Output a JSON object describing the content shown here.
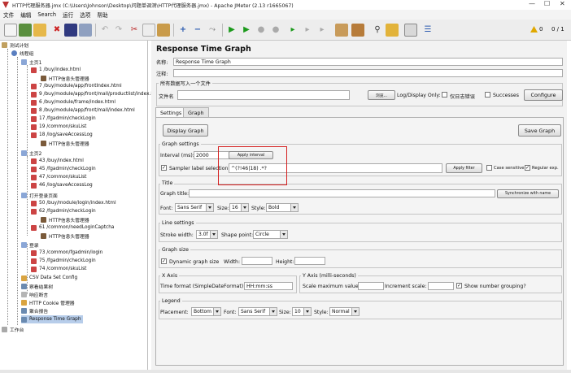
{
  "window": {
    "title": "HTTP代理服务器.jmx (C:\\Users\\Johnson\\Desktop\\问题单调测\\HTTP代理服务器.jmx) - Apache JMeter (2.13 r1665067)",
    "minimize": "—",
    "maximize": "☐",
    "close": "✕"
  },
  "menu": [
    "文件",
    "编辑",
    "Search",
    "运行",
    "选项",
    "帮助"
  ],
  "toolbar": {
    "warning_count": "0",
    "thread_count": "0 / 1"
  },
  "tree": {
    "items": [
      {
        "label": "测试计划"
      },
      {
        "label": "线程组"
      },
      {
        "label": "主页1"
      },
      {
        "label": "1 /buy/index.html"
      },
      {
        "label": "HTTP信息头管理器"
      },
      {
        "label": "7 /buy/module/app/frontIndex.html"
      },
      {
        "label": "9 /buy/module/app/front/mall/productlist/index.h"
      },
      {
        "label": "6 /buy/module/frame/index.html"
      },
      {
        "label": "8 /buy/module/app/front/mall/index.html"
      },
      {
        "label": "17 /fgadmin/checkLogin"
      },
      {
        "label": "19 /common/skuList"
      },
      {
        "label": "18 /log/saveAccessLog"
      },
      {
        "label": "HTTP信息头管理器"
      },
      {
        "label": "主页2"
      },
      {
        "label": "43 /buy/index.html"
      },
      {
        "label": "45 /fgadmin/checkLogin"
      },
      {
        "label": "47 /common/skuList"
      },
      {
        "label": "46 /log/saveAccessLog"
      },
      {
        "label": "打开登录页面"
      },
      {
        "label": "50 /buy/module/login/index.html"
      },
      {
        "label": "62 /fgadmin/checkLogin"
      },
      {
        "label": "HTTP信息头管理器"
      },
      {
        "label": "61 /common/needLoginCaptcha"
      },
      {
        "label": "HTTP信息头管理器"
      },
      {
        "label": "登录"
      },
      {
        "label": "73 /common/fgadmin/login"
      },
      {
        "label": "75 /fgadmin/checkLogin"
      },
      {
        "label": "74 /common/skuList"
      },
      {
        "label": "CSV Data Set Config"
      },
      {
        "label": "察看结果树"
      },
      {
        "label": "响应断言"
      },
      {
        "label": "HTTP Cookie 管理器"
      },
      {
        "label": "聚合报告"
      },
      {
        "label": "Response Time Graph"
      },
      {
        "label": "工作台"
      }
    ]
  },
  "panel": {
    "title": "Response Time Graph",
    "name_label": "名称:",
    "name_value": "Response Time Graph",
    "comment_label": "注释:",
    "comment_value": "",
    "file_group_title": "所有数据写入一个文件",
    "filename_label": "文件名",
    "filename_value": "",
    "browse_button": "浏览...",
    "log_display_label": "Log/Display Only:",
    "errors_only_label": "仅日志错误",
    "successes_label": "Successes",
    "configure_button": "Configure",
    "tabs": [
      "Settings",
      "Graph"
    ],
    "display_graph_button": "Display Graph",
    "save_graph_button": "Save Graph",
    "graph_settings_title": "Graph settings",
    "interval_label": "Interval (ms):",
    "interval_value": "2000",
    "apply_interval_button": "Apply interval",
    "sampler_label_selection": "Sampler label selection:",
    "sampler_regex_value": "^(?!46|18) .*?",
    "apply_filter_button": "Apply filter",
    "case_sensitive_label": "Case sensitive",
    "regular_exp_label": "Regular exp.",
    "title_section_title": "Title",
    "graph_title_label": "Graph title:",
    "graph_title_value": "",
    "synchronize_button": "Synchronize with name",
    "font_label": "Font:",
    "font_value": "Sans Serif",
    "size_label": "Size:",
    "size_value": "16",
    "style_label": "Style:",
    "style_value": "Bold",
    "line_settings_title": "Line settings",
    "stroke_width_label": "Stroke width:",
    "stroke_width_value": "3.0f",
    "shape_point_label": "Shape point:",
    "shape_point_value": "Circle",
    "graph_size_title": "Graph size",
    "dynamic_size_label": "Dynamic graph size",
    "width_label": "Width:",
    "width_value": "",
    "height_label": "Height:",
    "height_value": "",
    "x_axis_title": "X Axis",
    "time_format_label": "Time format (SimpleDateFormat):",
    "time_format_value": "HH:mm:ss",
    "y_axis_title": "Y Axis (milli-seconds)",
    "scale_max_label": "Scale maximum value:",
    "scale_max_value": "",
    "increment_label": "Increment scale:",
    "increment_value": "",
    "number_grouping_label": "Show number grouping?",
    "legend_title": "Legend",
    "placement_label": "Placement:",
    "placement_value": "Bottom",
    "legend_font_label": "Font:",
    "legend_font_value": "Sans Serif",
    "legend_size_label": "Size:",
    "legend_size_value": "10",
    "legend_style_label": "Style:",
    "legend_style_value": "Normal"
  }
}
